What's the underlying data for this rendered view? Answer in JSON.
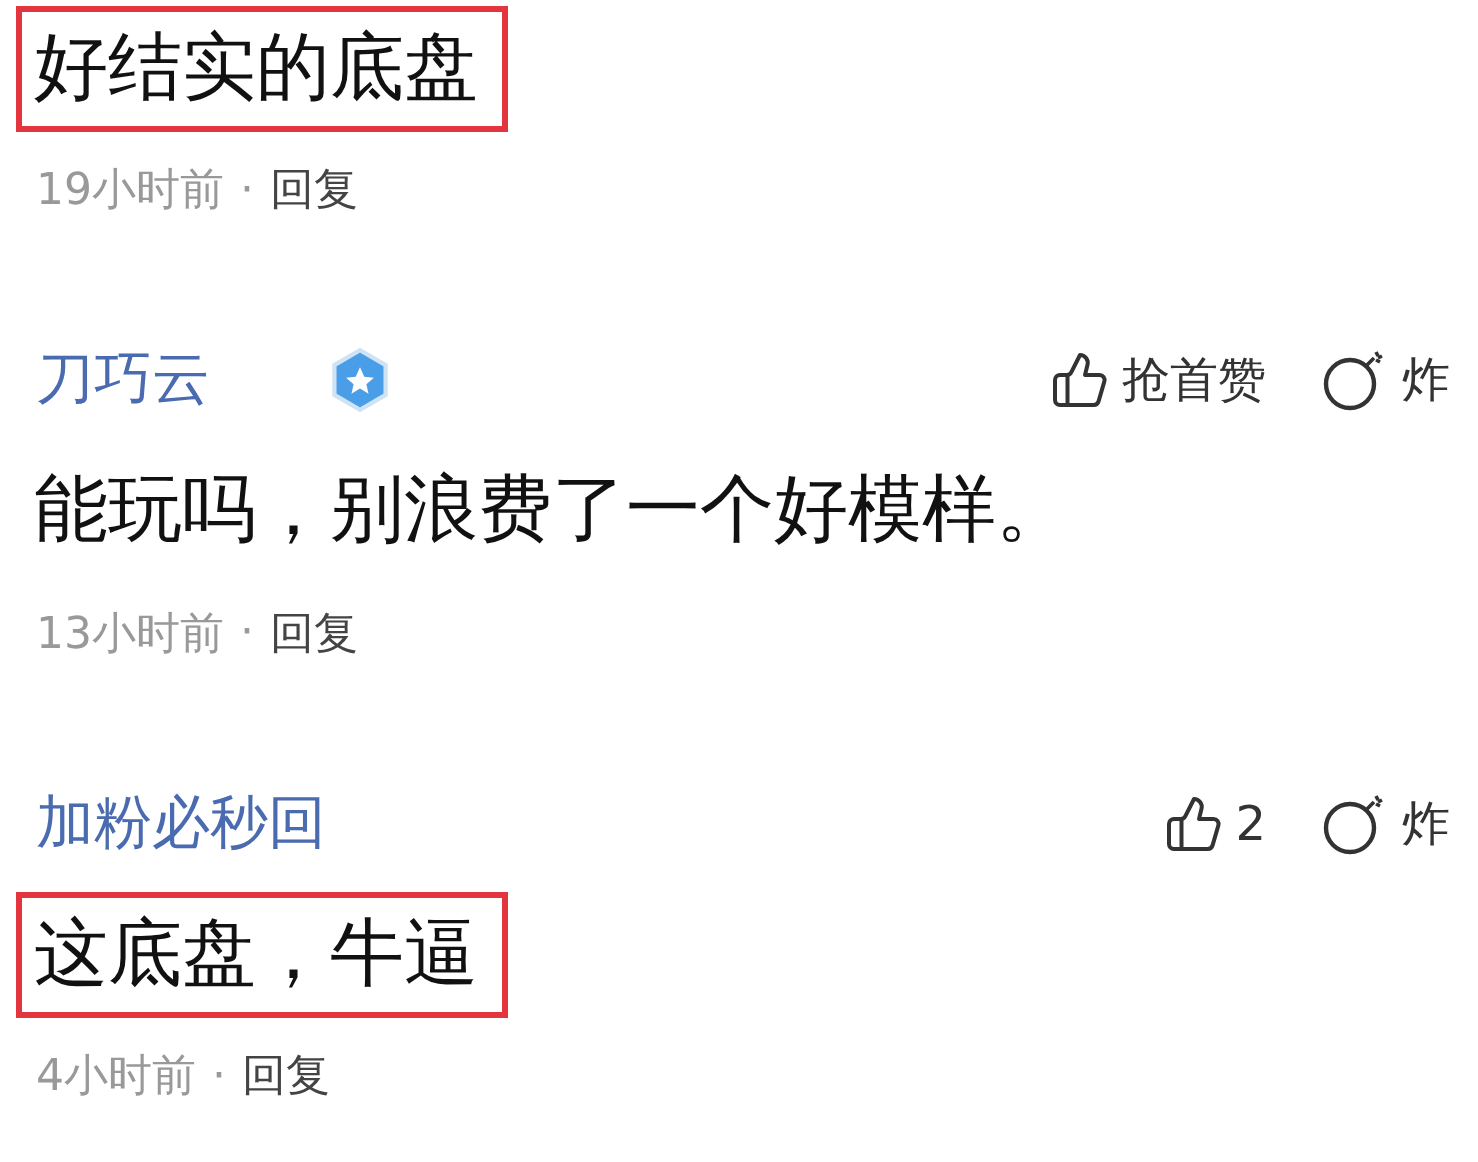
{
  "comments": [
    {
      "text": "好结实的底盘",
      "highlighted": true,
      "time": "19小时前",
      "separator": "·",
      "reply": "回复"
    },
    {
      "user": "刀巧云",
      "badge": true,
      "actions": {
        "like": "抢首赞",
        "bomb": "炸"
      },
      "text": "能玩吗，别浪费了一个好模样。",
      "highlighted": false,
      "time": "13小时前",
      "separator": "·",
      "reply": "回复"
    },
    {
      "user": "加粉必秒回",
      "actions": {
        "like": "2",
        "bomb": "炸"
      },
      "text": "这底盘，牛逼",
      "highlighted": true,
      "time": "4小时前",
      "separator": "·",
      "reply": "回复"
    }
  ]
}
